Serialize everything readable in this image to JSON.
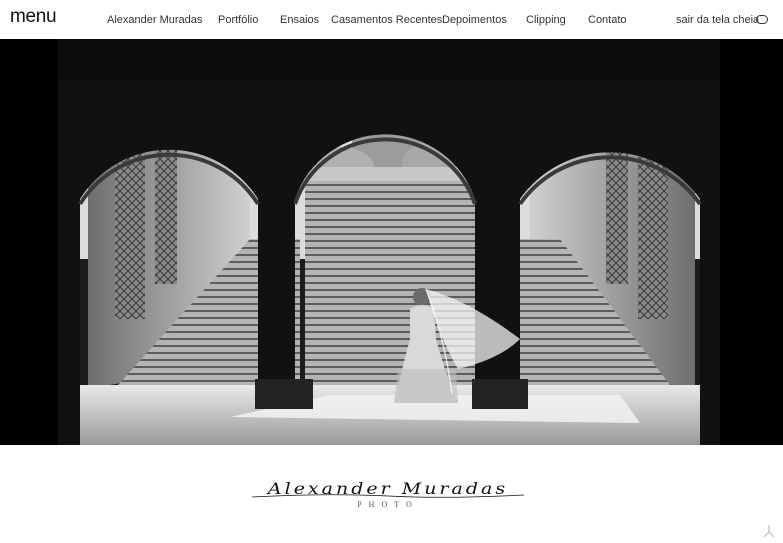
{
  "header": {
    "menu_label": "menu",
    "nav": [
      {
        "label": "Alexander Muradas"
      },
      {
        "label": "Portfólio"
      },
      {
        "label": "Ensaios"
      },
      {
        "label": "Casamentos Recentes"
      },
      {
        "label": "Depoimentos"
      },
      {
        "label": "Clipping"
      },
      {
        "label": "Contato"
      }
    ],
    "fullscreen_label": "sair da tela cheia",
    "fullscreen_icon": "fullscreen-exit-icon"
  },
  "hero": {
    "description_icon": "photo-bride-under-arches"
  },
  "footer": {
    "logo_script": "Alexander Muradas",
    "logo_sub": "PHOTO",
    "scroll_icon": "scroll-top-icon"
  },
  "colors": {
    "background": "#ffffff",
    "hero_bg": "#000000",
    "text": "#333333"
  }
}
